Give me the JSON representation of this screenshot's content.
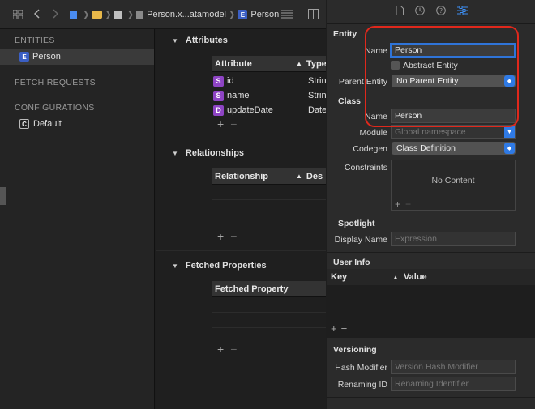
{
  "toolbar": {
    "breadcrumb_file": "Person.x...atamodel",
    "breadcrumb_entity": "Person",
    "breadcrumb_entity_badge": "E"
  },
  "sidebar": {
    "entities_header": "ENTITIES",
    "entities": [
      {
        "badge": "E",
        "label": "Person"
      }
    ],
    "fetch_requests_header": "FETCH REQUESTS",
    "configurations_header": "CONFIGURATIONS",
    "configurations": [
      {
        "badge": "C",
        "label": "Default"
      }
    ]
  },
  "editor": {
    "attributes": {
      "title": "Attributes",
      "col_attribute": "Attribute",
      "col_type": "Type",
      "rows": [
        {
          "badge": "S",
          "name": "id",
          "type": "Strin"
        },
        {
          "badge": "S",
          "name": "name",
          "type": "Strin"
        },
        {
          "badge": "D",
          "name": "updateDate",
          "type": "Date"
        }
      ]
    },
    "relationships": {
      "title": "Relationships",
      "col_relationship": "Relationship",
      "col_destination": "Des"
    },
    "fetched_properties": {
      "title": "Fetched Properties",
      "col_fetched_property": "Fetched Property"
    },
    "plus": "+",
    "minus": "−"
  },
  "inspector": {
    "entity_section": "Entity",
    "name_label": "Name",
    "name_value": "Person",
    "abstract_entity_label": "Abstract Entity",
    "parent_entity_label": "Parent Entity",
    "parent_entity_value": "No Parent Entity",
    "class_section": "Class",
    "class_name_label": "Name",
    "class_name_value": "Person",
    "module_label": "Module",
    "module_placeholder": "Global namespace",
    "codegen_label": "Codegen",
    "codegen_value": "Class Definition",
    "constraints_label": "Constraints",
    "constraints_empty": "No Content",
    "spotlight_section": "Spotlight",
    "display_name_label": "Display Name",
    "display_name_placeholder": "Expression",
    "user_info_section": "User Info",
    "user_info_key": "Key",
    "user_info_value": "Value",
    "versioning_section": "Versioning",
    "hash_modifier_label": "Hash Modifier",
    "hash_modifier_placeholder": "Version Hash Modifier",
    "renaming_id_label": "Renaming ID",
    "renaming_id_placeholder": "Renaming Identifier"
  },
  "colors": {
    "accent": "#3d8ef0",
    "highlight_ring": "#e0281c",
    "entity_badge": "#3b5fc4",
    "attribute_badge": "#8e44c4"
  }
}
